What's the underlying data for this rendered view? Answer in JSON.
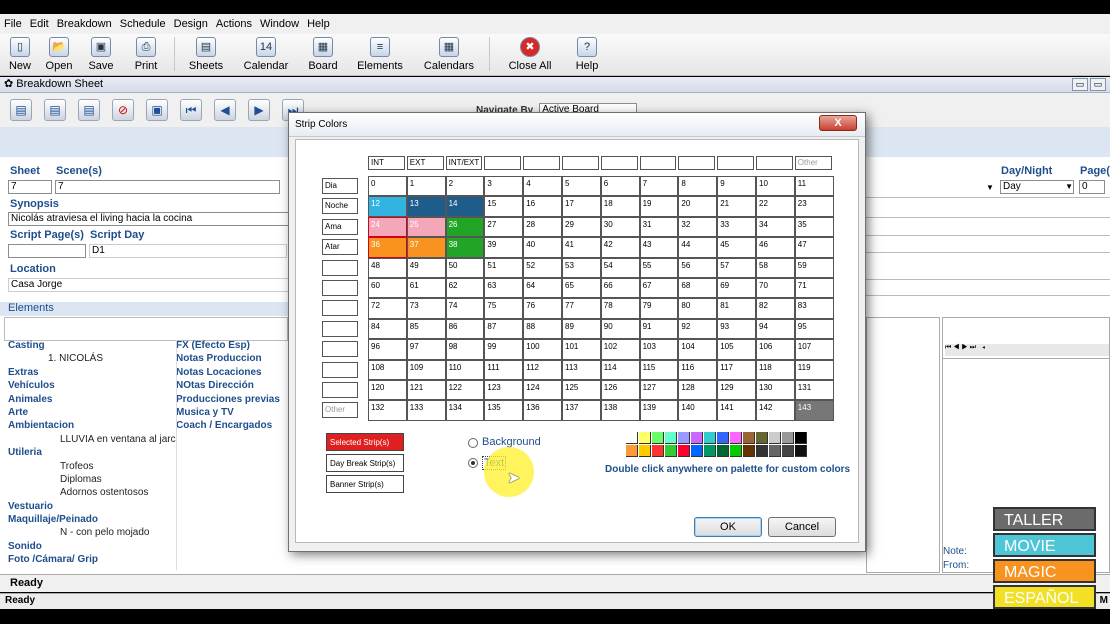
{
  "menu": [
    "File",
    "Edit",
    "Breakdown",
    "Schedule",
    "Design",
    "Actions",
    "Window",
    "Help"
  ],
  "toolbar": [
    {
      "label": "New",
      "icon": "new-icon"
    },
    {
      "label": "Open",
      "icon": "open-icon"
    },
    {
      "label": "Save",
      "icon": "save-icon"
    },
    {
      "label": "Print",
      "icon": "print-icon"
    },
    {
      "label": "Sheets",
      "icon": "sheets-icon"
    },
    {
      "label": "Calendar",
      "icon": "calendar-icon"
    },
    {
      "label": "Board",
      "icon": "board-icon"
    },
    {
      "label": "Elements",
      "icon": "elements-icon"
    },
    {
      "label": "Calendars",
      "icon": "calendars-icon"
    },
    {
      "label": "Close All",
      "icon": "close-all-icon"
    },
    {
      "label": "Help",
      "icon": "help-icon"
    }
  ],
  "window_title": "Breakdown Sheet",
  "navigate": {
    "label": "Navigate By",
    "value": "Active Board"
  },
  "sheet": {
    "sheet_label": "Sheet",
    "sheet_value": "7",
    "scenes_label": "Scene(s)",
    "scenes_value": "7",
    "synopsis_label": "Synopsis",
    "synopsis_value": "Nicolás atraviesa el living hacia la cocina",
    "script_page_label": "Script Page(s)",
    "script_day_label": "Script Day",
    "script_day_value": "D1",
    "location_label": "Location",
    "location_value": "Casa Jorge",
    "elements_label": "Elements",
    "daynight_label": "Day/Night",
    "daynight_value": "Day",
    "pages_label": "Page(s",
    "pages_value": "0"
  },
  "elements_left": [
    {
      "cat": "Casting",
      "items": [
        "1. NICOLÁS"
      ]
    },
    {
      "cat": "Extras",
      "items": []
    },
    {
      "cat": "Vehículos",
      "items": []
    },
    {
      "cat": "Animales",
      "items": []
    },
    {
      "cat": "Arte",
      "items": []
    },
    {
      "cat": "Ambientacion",
      "items": [
        "LLUVIA en ventana al jarc"
      ]
    },
    {
      "cat": "Utileria",
      "items": [
        "Trofeos",
        "Diplomas",
        "Adornos ostentosos"
      ]
    },
    {
      "cat": "Vestuario",
      "items": []
    },
    {
      "cat": "Maquillaje/Peinado",
      "items": [
        "N - con pelo mojado"
      ]
    },
    {
      "cat": "Sonido",
      "items": []
    },
    {
      "cat": "Foto /Cámara/ Grip",
      "items": []
    }
  ],
  "elements_right": [
    "FX (Efecto Esp)",
    "Notas Produccion",
    "Notas Locaciones",
    "NOtas Dirección",
    "Producciones previas",
    "Musica y TV",
    "Coach / Encargados"
  ],
  "notes": {
    "note_label": "Note:",
    "from_label": "From:"
  },
  "status": {
    "ready1": "Ready",
    "ready2": "Ready",
    "corner": "M"
  },
  "dialog": {
    "title": "Strip Colors",
    "close": "X",
    "col_headers": [
      "INT",
      "EXT",
      "INT/EXT",
      "",
      "",
      "",
      "",
      "",
      "",
      "",
      "",
      "Other"
    ],
    "row_labels": [
      "Dia",
      "Noche",
      "Ama",
      "Atar",
      "",
      "",
      "",
      "",
      "",
      "",
      "",
      "Other"
    ],
    "colored_cells": {
      "12": "#33b3e0",
      "13": "#1e5c8c",
      "14": "#1e5c8c",
      "24": "#f4a7b9",
      "25": "#f4a7b9",
      "26": "#22a526",
      "36": "#f7931e",
      "37": "#f7931e",
      "38": "#22a526",
      "143": "#777777"
    },
    "strip_buttons": [
      "Selected Strip(s)",
      "Day Break Strip(s)",
      "Banner Strip(s)"
    ],
    "radio_background": "Background",
    "radio_text": "Text",
    "palette_hint": "Double click anywhere on palette for custom colors",
    "palette_row1": [
      "#ffffff",
      "#ffff66",
      "#66ff66",
      "#66ffcc",
      "#9999ff",
      "#cc66ff",
      "#33cccc",
      "#3366ff",
      "#ff66ff",
      "#996633",
      "#666633",
      "#cccccc",
      "#999999",
      "#000000"
    ],
    "palette_row2": [
      "#ff9933",
      "#ffcc00",
      "#ff3333",
      "#33cc33",
      "#ff0033",
      "#0066ff",
      "#009966",
      "#006633",
      "#00cc00",
      "#663300",
      "#333333",
      "#666666",
      "#444444",
      "#111111"
    ],
    "ok": "OK",
    "cancel": "Cancel"
  },
  "logo": [
    "TALLER",
    "MOVIE",
    "MAGIC",
    "ESPAÑOL"
  ],
  "logo_colors": [
    "#6b6b6b",
    "#4fc6d8",
    "#f7931e",
    "#f1e025"
  ]
}
